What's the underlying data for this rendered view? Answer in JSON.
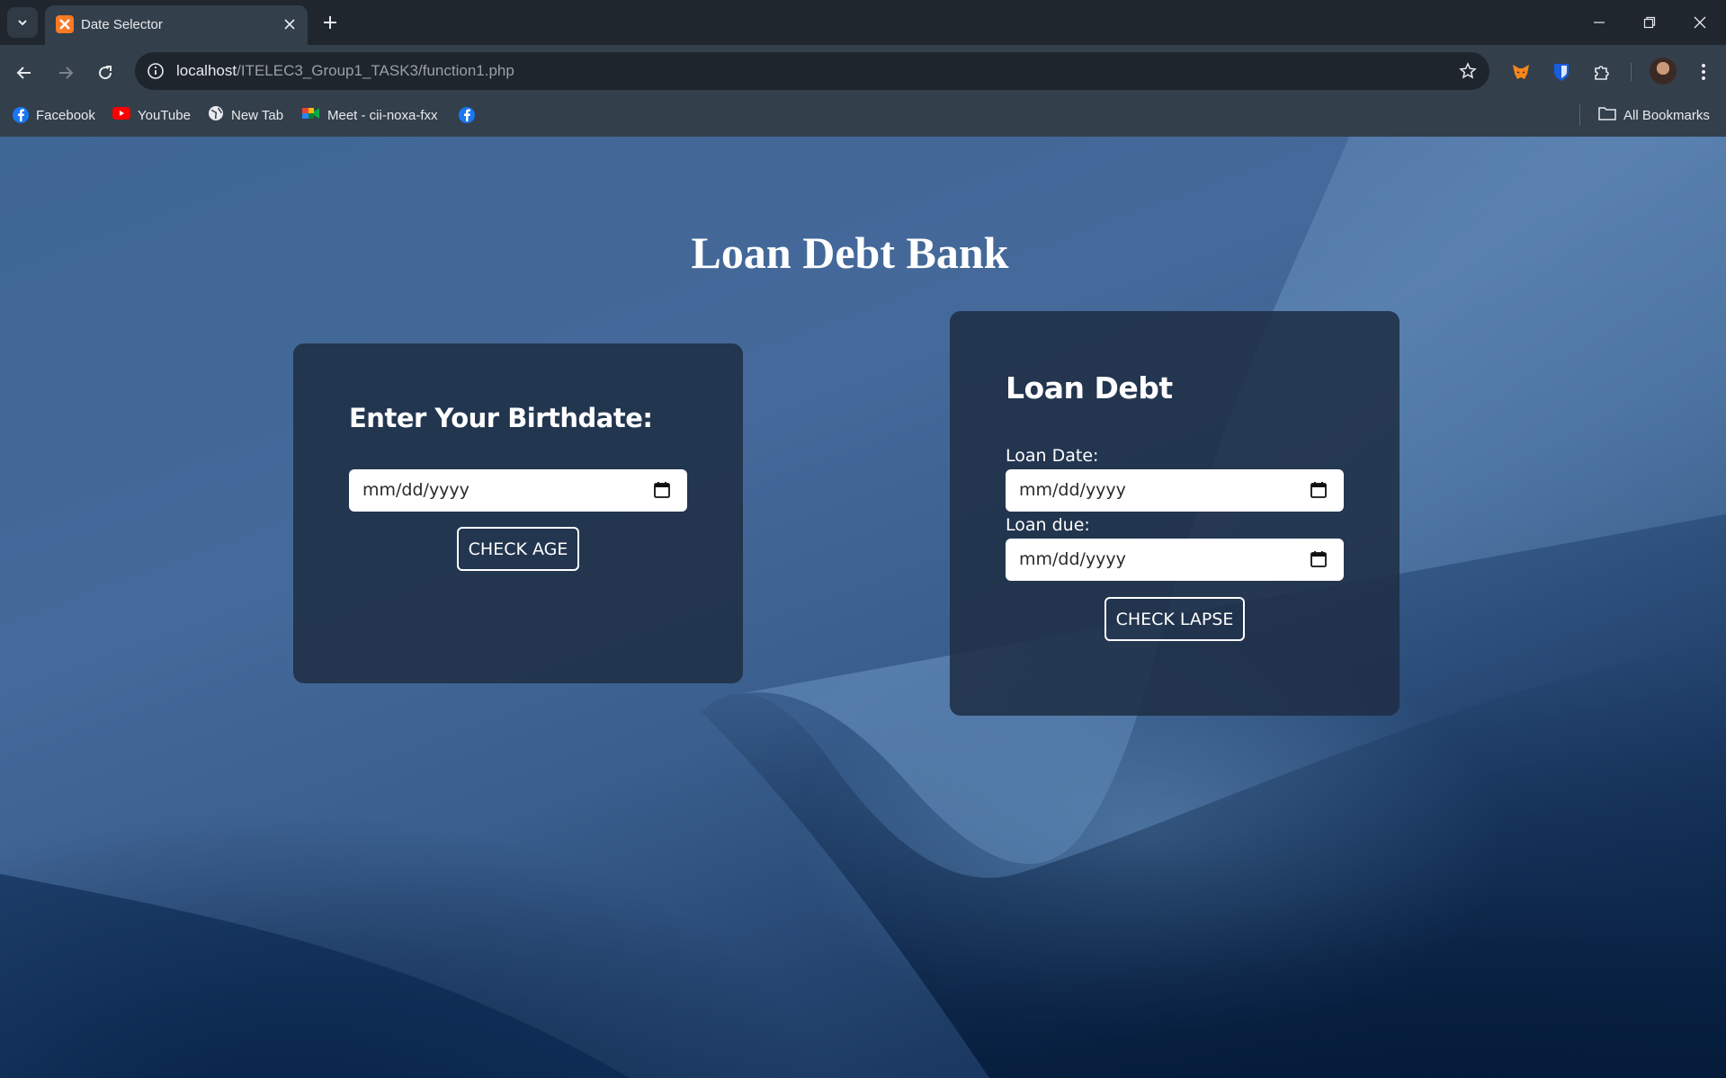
{
  "browser": {
    "tab_title": "Date Selector",
    "url_host": "localhost",
    "url_path": "/ITELEC3_Group1_TASK3/function1.php",
    "bookmarks": [
      {
        "label": "Facebook",
        "icon": "facebook-icon"
      },
      {
        "label": "YouTube",
        "icon": "youtube-icon"
      },
      {
        "label": "New Tab",
        "icon": "globe-icon"
      },
      {
        "label": "Meet - cii-noxa-fxx",
        "icon": "meet-icon"
      },
      {
        "label": "",
        "icon": "facebook-icon"
      }
    ],
    "all_bookmarks_label": "All Bookmarks"
  },
  "page": {
    "title": "Loan Debt Bank",
    "birth_card": {
      "heading": "Enter Your Birthdate:",
      "date_placeholder": "mm/dd/yyyy",
      "button_label": "CHECK AGE"
    },
    "loan_card": {
      "heading": "Loan Debt",
      "loan_date_label": "Loan Date:",
      "loan_date_placeholder": "mm/dd/yyyy",
      "loan_due_label": "Loan due:",
      "loan_due_placeholder": "mm/dd/yyyy",
      "button_label": "CHECK LAPSE"
    }
  },
  "colors": {
    "accent_tab_favicon": "#fb7a24",
    "card_background": "#1e2d44",
    "page_background": "#3f6795"
  }
}
